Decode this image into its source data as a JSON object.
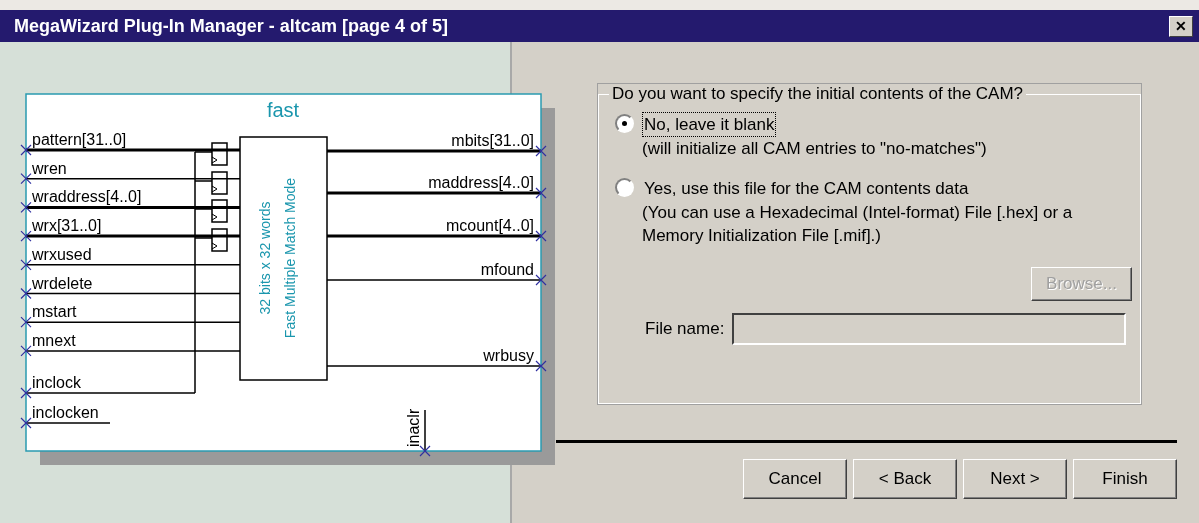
{
  "window": {
    "title": "MegaWizard Plug-In Manager - altcam [page 4 of 5]",
    "close": "✕"
  },
  "diagram": {
    "title": "fast",
    "block_lines": [
      "32 bits x 32 words",
      "Fast Multiple Match Mode"
    ],
    "left_ports": [
      {
        "label": "pattern[31..0]",
        "kind": "bus"
      },
      {
        "label": "wren",
        "kind": "wire"
      },
      {
        "label": "wraddress[4..0]",
        "kind": "bus"
      },
      {
        "label": "wrx[31..0]",
        "kind": "bus"
      },
      {
        "label": "wrxused",
        "kind": "wire"
      },
      {
        "label": "wrdelete",
        "kind": "wire"
      },
      {
        "label": "mstart",
        "kind": "wire"
      },
      {
        "label": "mnext",
        "kind": "wire"
      },
      {
        "label": "inclock",
        "kind": "clock"
      },
      {
        "label": "inclocken",
        "kind": "enable"
      }
    ],
    "right_ports": [
      {
        "label": "mbits[31..0]",
        "kind": "bus"
      },
      {
        "label": "maddress[4..0]",
        "kind": "bus"
      },
      {
        "label": "mcount[4..0]",
        "kind": "bus"
      },
      {
        "label": "mfound",
        "kind": "wire"
      },
      {
        "label": "wrbusy",
        "kind": "wire"
      }
    ],
    "bottom_port": {
      "label": "inaclr"
    }
  },
  "group": {
    "legend": "Do you want to specify the initial contents of the CAM?",
    "options": [
      {
        "label": "No, leave it blank",
        "note": "(will initialize all CAM entries to \"no-matches\")",
        "selected": true
      },
      {
        "label": "Yes, use this file for the CAM contents data",
        "note": "(You can use a Hexadecimal (Intel-format) File [.hex] or a Memory Initialization File [.mif].)",
        "selected": false
      }
    ],
    "browse": {
      "label": "Browse...",
      "disabled": true
    },
    "file_name": {
      "label": "File name:",
      "disabled": true
    }
  },
  "buttons": [
    {
      "label": "Cancel"
    },
    {
      "label": "< Back"
    },
    {
      "label": "Next >"
    },
    {
      "label": "Finish"
    }
  ]
}
